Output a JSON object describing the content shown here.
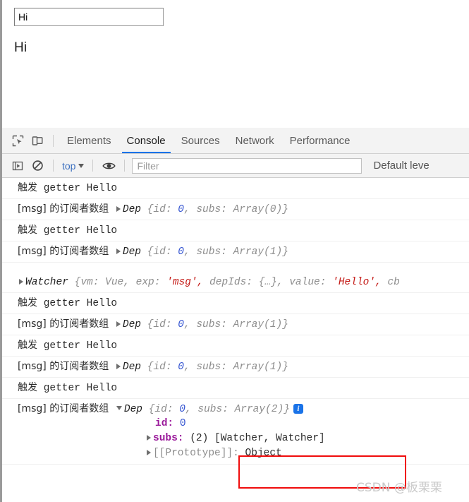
{
  "page": {
    "input_value": "Hi",
    "input_placeholder": "",
    "rendered_text": "Hi"
  },
  "devtools": {
    "toolbar_icons": [
      {
        "name": "inspect-element-icon",
        "glyph": "inspect"
      },
      {
        "name": "device-toolbar-icon",
        "glyph": "device"
      }
    ],
    "tabs": [
      {
        "label": "Elements",
        "active": false
      },
      {
        "label": "Console",
        "active": true
      },
      {
        "label": "Sources",
        "active": false
      },
      {
        "label": "Network",
        "active": false
      },
      {
        "label": "Performance",
        "active": false
      }
    ],
    "filterbar": {
      "sidebar_toggle_icon": "sidebar-toggle-icon",
      "clear_console_icon": "clear-console-icon",
      "context_value": "top",
      "eye_icon": "live-expression-eye-icon",
      "filter_value": "",
      "filter_placeholder": "Filter",
      "level_value": "Default leve"
    },
    "accent_color": "#1a73e8"
  },
  "console": {
    "messages": [
      {
        "type": "text",
        "cn": "触发",
        "en": "getter Hello"
      },
      {
        "type": "object",
        "cn": "[msg] 的订阅者数组",
        "expanded": false,
        "objname": "Dep",
        "open": "{",
        "k1": "id:",
        "v1": "0",
        "sep": ",",
        "k2": "subs:",
        "v2": "Array(0)",
        "close": "}"
      },
      {
        "type": "text",
        "cn": "触发",
        "en": "getter Hello"
      },
      {
        "type": "object",
        "cn": "[msg] 的订阅者数组",
        "expanded": false,
        "objname": "Dep",
        "open": "{",
        "k1": "id:",
        "v1": "0",
        "sep": ",",
        "k2": "subs:",
        "v2": "Array(1)",
        "close": "}"
      },
      {
        "type": "blank"
      },
      {
        "type": "watcher",
        "objname": "Watcher",
        "open": "{",
        "p1": "vm:",
        "v1": "Vue,",
        "p2": "exp:",
        "v2": "'msg',",
        "p3": "depIds:",
        "v3": "{…},",
        "p4": "value:",
        "v4": "'Hello',",
        "p5": "cb"
      },
      {
        "type": "text",
        "cn": "触发",
        "en": "getter Hello"
      },
      {
        "type": "object",
        "cn": "[msg] 的订阅者数组",
        "expanded": false,
        "objname": "Dep",
        "open": "{",
        "k1": "id:",
        "v1": "0",
        "sep": ",",
        "k2": "subs:",
        "v2": "Array(1)",
        "close": "}"
      },
      {
        "type": "text",
        "cn": "触发",
        "en": "getter Hello"
      },
      {
        "type": "object",
        "cn": "[msg] 的订阅者数组",
        "expanded": false,
        "objname": "Dep",
        "open": "{",
        "k1": "id:",
        "v1": "0",
        "sep": ",",
        "k2": "subs:",
        "v2": "Array(1)",
        "close": "}"
      },
      {
        "type": "text",
        "cn": "触发",
        "en": "getter Hello"
      },
      {
        "type": "expanded",
        "cn": "[msg] 的订阅者数组",
        "objname": "Dep",
        "open": "{",
        "k1": "id:",
        "v1": "0",
        "sep": ",",
        "k2": "subs:",
        "v2": "Array(2)",
        "close": "}",
        "info_badge": "i",
        "props": [
          {
            "key": "id:",
            "val": "0",
            "kind": "num",
            "disc": false
          },
          {
            "key": "subs:",
            "val": "(2) [Watcher, Watcher]",
            "kind": "plain",
            "disc": true
          },
          {
            "key": "[[Prototype]]:",
            "val": "Object",
            "kind": "proto",
            "disc": true
          }
        ]
      }
    ]
  },
  "annotation": {
    "rect_color": "#f00c0c"
  },
  "watermark": {
    "text": "CSDN @板栗栗"
  }
}
